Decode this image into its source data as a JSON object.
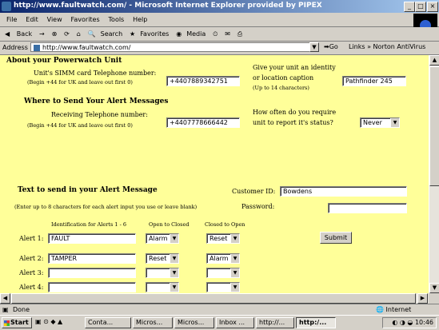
{
  "window": {
    "title": "http://www.faultwatch.com/ - Microsoft Internet Explorer provided by PIPEX",
    "min": "_",
    "max": "□",
    "close": "×"
  },
  "menu": [
    "File",
    "Edit",
    "View",
    "Favorites",
    "Tools",
    "Help"
  ],
  "toolbar": {
    "back": "Back",
    "forward": "→",
    "search": "Search",
    "favorites": "Favorites",
    "media": "Media"
  },
  "address": {
    "label": "Address",
    "value": "http://www.faultwatch.com/",
    "go": "Go",
    "links": "Links",
    "antivirus": "Norton AntiVirus"
  },
  "form": {
    "section_unit": "About your Powerwatch Unit",
    "simm_label": "Unit's SIMM card Telephone number:",
    "simm_hint": "(Begin +44 for UK and leave out first 0)",
    "simm_value": "+4407889342751",
    "identity_label1": "Give your unit an identity",
    "identity_label2": "or location caption",
    "identity_hint": "(Up to 14 characters)",
    "identity_value": "Pathfinder 245",
    "section_alerts": "Where to Send Your Alert Messages",
    "receiving_label": "Receiving Telephone number:",
    "receiving_hint": "(Begin +44 for UK and leave out first 0)",
    "receiving_value": "+4407778666442",
    "report_label1": "How often do you require",
    "report_label2": "unit to report it's status?",
    "report_value": "Never",
    "section_text": "Text to send in your Alert Message",
    "customer_label": "Customer ID:",
    "customer_value": "Bowdens",
    "password_label": "Password:",
    "password_value": "",
    "alerts_hint": "(Enter up to 8 characters for each alert input you use or leave blank)",
    "col_ident": "Identification for Alerts 1 - 6",
    "col_open": "Open to Closed",
    "col_closed": "Closed to Open",
    "submit": "Submit",
    "alerts": [
      {
        "label": "Alert 1:",
        "ident": "FAULT",
        "open": "Alarm",
        "closed": "Reset"
      },
      {
        "label": "Alert 2:",
        "ident": "TAMPER",
        "open": "Reset",
        "closed": "Alarm"
      },
      {
        "label": "Alert 3:",
        "ident": "",
        "open": "",
        "closed": ""
      },
      {
        "label": "Alert 4:",
        "ident": "",
        "open": "",
        "closed": ""
      }
    ]
  },
  "status": {
    "text": "Done",
    "zone": "Internet"
  },
  "taskbar": {
    "start": "Start",
    "tasks": [
      "Conta...",
      "Micros...",
      "Micros...",
      "Inbox ...",
      "http://...",
      "http:/..."
    ],
    "clock": "10:46"
  }
}
